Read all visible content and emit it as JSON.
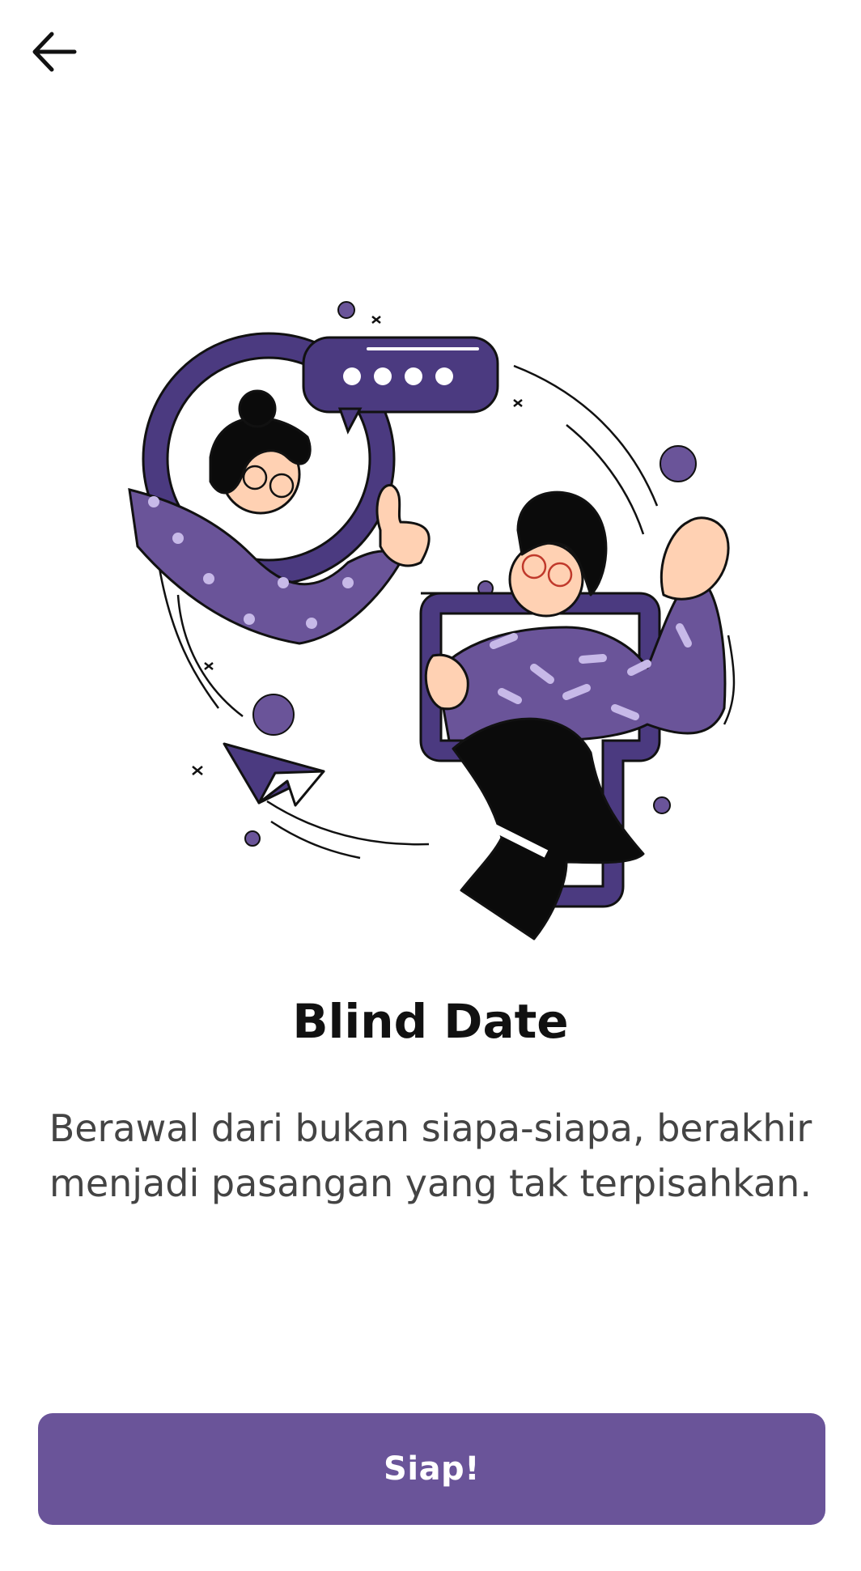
{
  "header": {
    "back_icon": "arrow-left-icon"
  },
  "illustration": {
    "accent_color": "#4b3a80",
    "light_color": "#6a5499",
    "skin_color": "#ffd1b3"
  },
  "content": {
    "title": "Blind Date",
    "description": "Berawal dari bukan siapa-siapa, berakhir menjadi pasangan yang tak terpisahkan."
  },
  "cta": {
    "label": "Siap!",
    "color": "#6a5499"
  }
}
